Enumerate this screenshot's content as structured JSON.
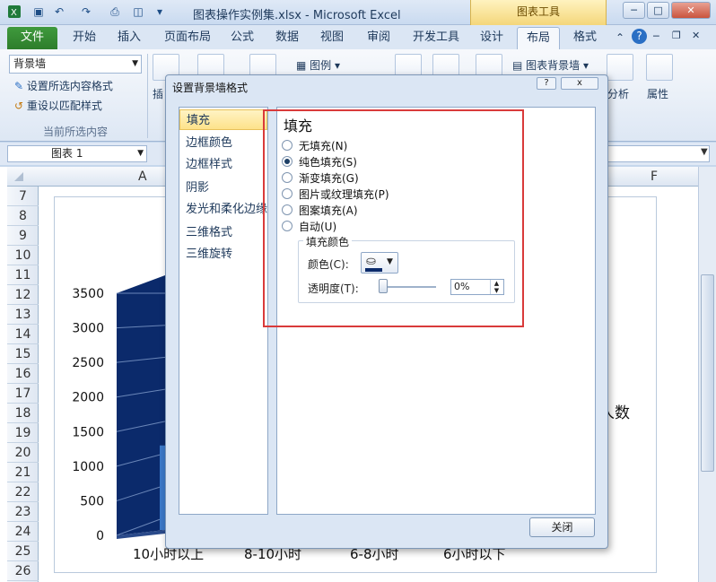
{
  "window": {
    "title": "图表操作实例集.xlsx - Microsoft Excel",
    "context_tab": "图表工具"
  },
  "tabs": [
    "文件",
    "开始",
    "插入",
    "页面布局",
    "公式",
    "数据",
    "视图",
    "审阅",
    "开发工具",
    "设计",
    "布局",
    "格式"
  ],
  "active_tab": "布局",
  "ribbon": {
    "element_select": "背景墙",
    "format_selection": "设置所选内容格式",
    "reset_style": "重设以匹配样式",
    "group_current": "当前所选内容",
    "insert_label": "插",
    "legend_label": "图例",
    "chart_wall_label": "图表背景墙",
    "analysis_label": "分析",
    "properties_label": "属性"
  },
  "formula_bar": {
    "name_box": "图表 1"
  },
  "sheet": {
    "columns": [
      "A",
      "F"
    ],
    "rows": [
      "7",
      "8",
      "9",
      "10",
      "11",
      "12",
      "13",
      "14",
      "15",
      "16",
      "17",
      "18",
      "19",
      "20",
      "21",
      "22",
      "23",
      "24",
      "25",
      "26"
    ]
  },
  "chart": {
    "legend_fragment": "人数"
  },
  "chart_data": {
    "type": "bar",
    "categories": [
      "10小时以上",
      "8-10小时",
      "6-8小时",
      "6小时以下"
    ],
    "ylim": [
      0,
      3500
    ],
    "yticks": [
      "3500",
      "3000",
      "2500",
      "2000",
      "1500",
      "1000",
      "500",
      "0"
    ]
  },
  "dialog": {
    "title": "设置背景墙格式",
    "nav": [
      "填充",
      "边框颜色",
      "边框样式",
      "阴影",
      "发光和柔化边缘",
      "三维格式",
      "三维旋转"
    ],
    "selected_nav": "填充",
    "section_title": "填充",
    "options": [
      "无填充(N)",
      "纯色填充(S)",
      "渐变填充(G)",
      "图片或纹理填充(P)",
      "图案填充(A)",
      "自动(U)"
    ],
    "selected_option": "纯色填充(S)",
    "fill_color_group": "填充颜色",
    "color_label": "颜色(C):",
    "transparency_label": "透明度(T):",
    "transparency_value": "0%",
    "close_button": "关闭",
    "help": "?",
    "close_x": "x"
  },
  "colors": {
    "highlight_border": "#d93a3a",
    "file_tab": "#3f9a3d",
    "bar_fill": "#0b2a6b"
  }
}
